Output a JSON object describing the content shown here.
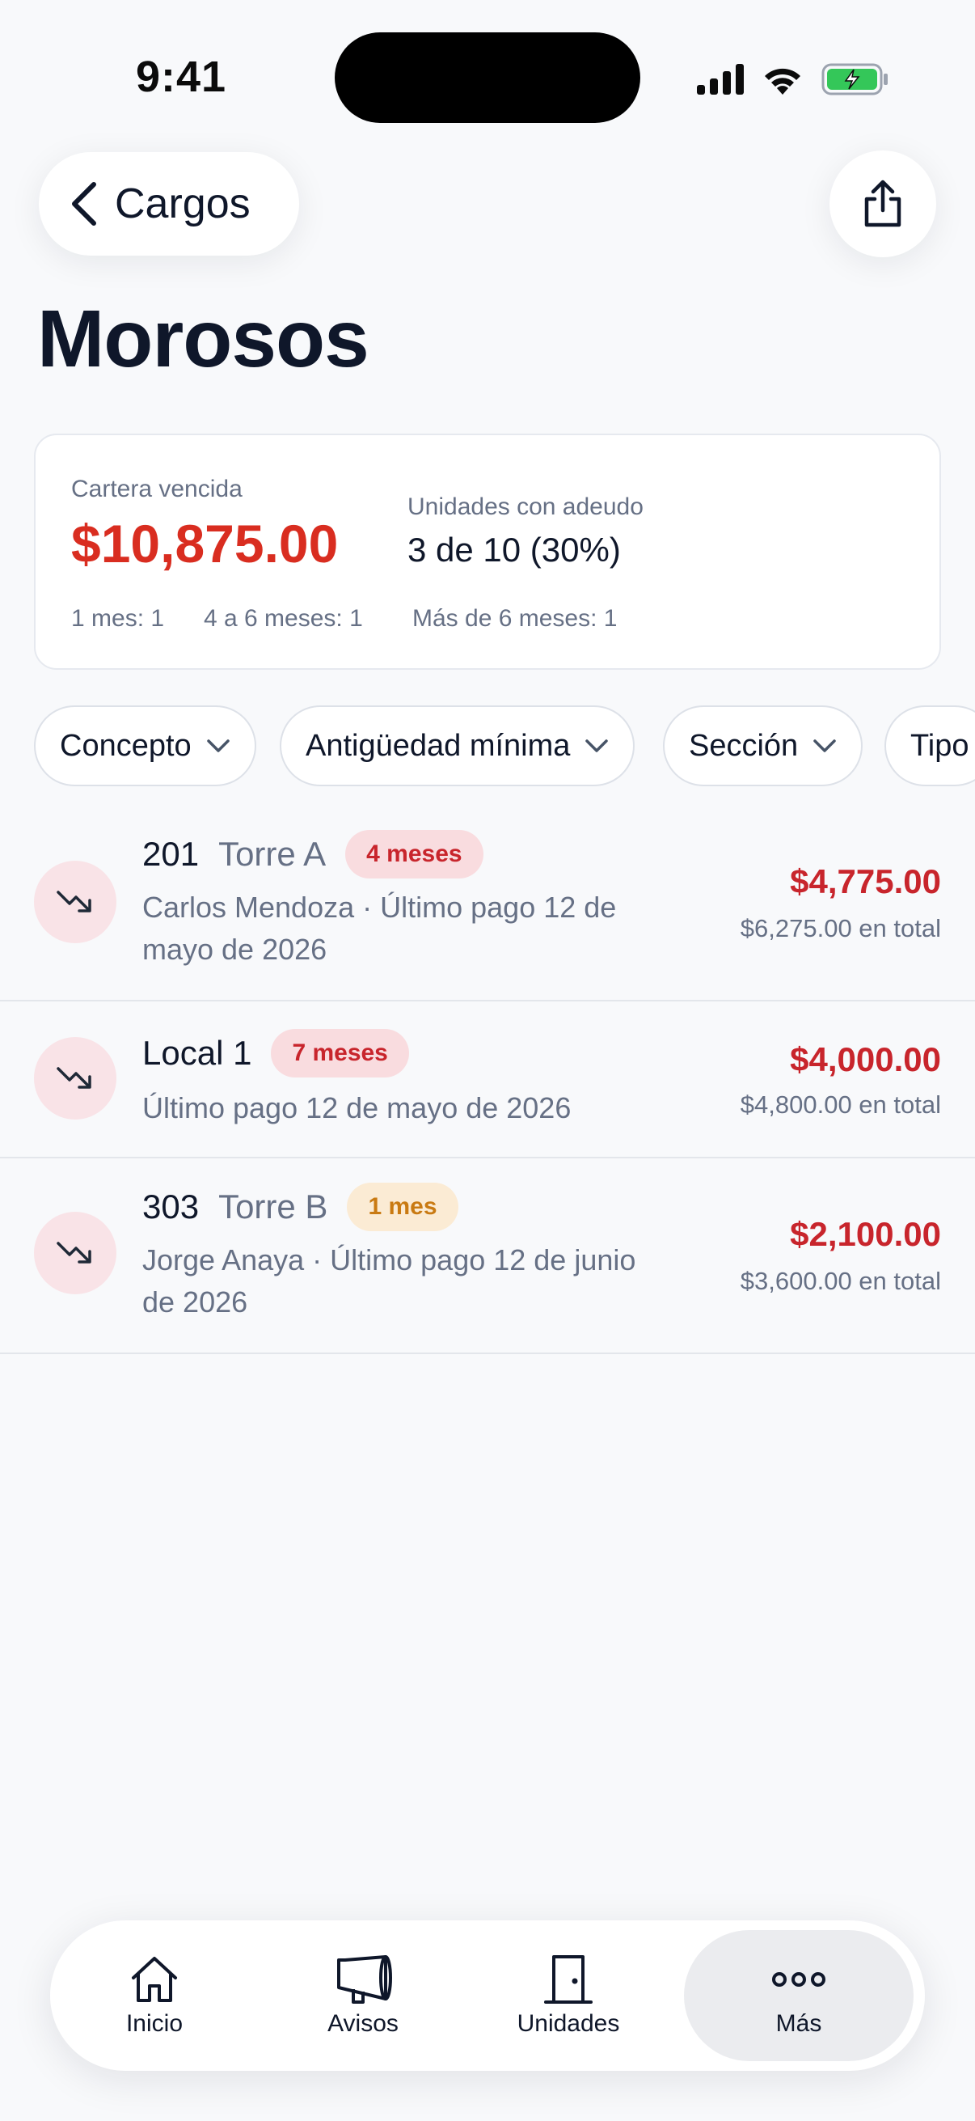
{
  "status_bar": {
    "time": "9:41"
  },
  "header": {
    "back_label": "Cargos",
    "title": "Morosos"
  },
  "summary": {
    "overdue_label": "Cartera vencida",
    "overdue_amount": "$10,875.00",
    "units_label": "Unidades con adeudo",
    "units_value": "3 de 10 (30%)",
    "aging": [
      "1 mes: 1",
      "4 a 6 meses: 1",
      "Más de 6 meses: 1"
    ]
  },
  "filters": [
    "Concepto",
    "Antigüedad mínima",
    "Sección",
    "Tipo"
  ],
  "debtors": [
    {
      "unit": "201",
      "tower": "Torre A",
      "badge": "4 meses",
      "subtitle_line1": "Carlos Mendoza · Último pago 12 de",
      "subtitle_line2": "mayo de 2026",
      "amount": "$4,775.00",
      "total": "$6,275.00 en total"
    },
    {
      "unit": "Local 1",
      "tower": "",
      "badge": "7 meses",
      "subtitle_line1": "Último pago 12 de mayo de 2026",
      "subtitle_line2": "",
      "amount": "$4,000.00",
      "total": "$4,800.00 en total"
    },
    {
      "unit": "303",
      "tower": "Torre B",
      "badge": "1 mes",
      "subtitle_line1": "Jorge Anaya · Último pago 12 de junio",
      "subtitle_line2": "de 2026",
      "amount": "$2,100.00",
      "total": "$3,600.00 en total"
    }
  ],
  "tabbar": {
    "items": [
      {
        "label": "Inicio",
        "icon": "house-icon"
      },
      {
        "label": "Avisos",
        "icon": "megaphone-icon"
      },
      {
        "label": "Unidades",
        "icon": "door-icon"
      },
      {
        "label": "Más",
        "icon": "more-dots-icon"
      }
    ],
    "active": "Más"
  },
  "colors": {
    "accent_red": "#D92D20",
    "badge_red_bg": "#F9DCDF",
    "badge_amber_bg": "#FBEBD4",
    "badge_amber_text": "#C97A12",
    "background": "#F8F9FB",
    "battery_green": "#34C759"
  }
}
